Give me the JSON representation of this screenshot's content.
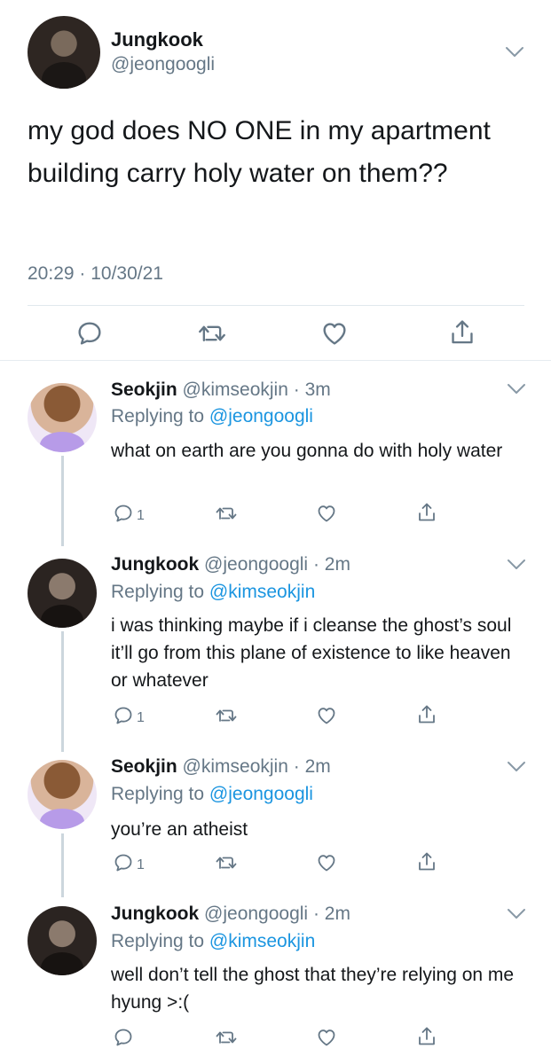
{
  "main_tweet": {
    "name": "Jungkook",
    "handle": "@jeongoogli",
    "text": "my god does NO ONE in my apartment building carry holy water on them??",
    "timestamp": "20:29 · 10/30/21"
  },
  "replies": [
    {
      "name": "Seokjin",
      "handle": "@kimseokjin",
      "time": "· 3m",
      "replying_label": "Replying to",
      "replying_to": "@jeongoogli",
      "text": "what on earth are you gonna do with holy water",
      "reply_count": "1"
    },
    {
      "name": "Jungkook",
      "handle": "@jeongoogli",
      "time": "· 2m",
      "replying_label": "Replying to",
      "replying_to": "@kimseokjin",
      "text": "i was thinking maybe if i cleanse the ghost’s soul it’ll go from this plane of existence to like heaven or whatever",
      "reply_count": "1"
    },
    {
      "name": "Seokjin",
      "handle": "@kimseokjin",
      "time": "· 2m",
      "replying_label": "Replying to",
      "replying_to": "@jeongoogli",
      "text": "you’re an atheist",
      "reply_count": "1"
    },
    {
      "name": "Jungkook",
      "handle": "@jeongoogli",
      "time": "· 2m",
      "replying_label": "Replying to",
      "replying_to": "@kimseokjin",
      "text": "well don’t tell the ghost that they’re relying on me hyung >:(",
      "reply_count": ""
    }
  ],
  "icons": [
    "reply-icon",
    "retweet-icon",
    "like-icon",
    "share-icon",
    "chevron-down-icon"
  ],
  "colors": {
    "text": "#14171a",
    "muted": "#657786",
    "link": "#1b95e0",
    "thread_line": "#ccd6dd"
  }
}
